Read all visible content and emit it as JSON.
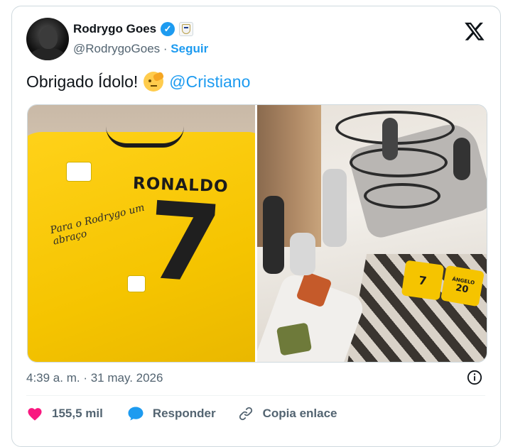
{
  "author": {
    "display_name": "Rodrygo Goes",
    "handle": "@RodrygoGoes",
    "separator": "·",
    "follow_label": "Seguir",
    "verified": true,
    "affiliation": "Real Madrid crest"
  },
  "tweet": {
    "text": "Obrigado Ídolo!",
    "emoji": "saluting-face",
    "mention": "@Cristiano"
  },
  "media": {
    "left_photo": {
      "shirt_name": "RONALDO",
      "shirt_number": "7",
      "autograph": "Para o Rodrygo um abraço"
    },
    "right_photo": {
      "jersey_left_number": "7",
      "jersey_right_name": "ÁNGELO",
      "jersey_right_number": "20"
    }
  },
  "timestamp": "4:39 a. m. · 31 may. 2026",
  "actions": {
    "like_count": "155,5 mil",
    "reply_label": "Responder",
    "copy_link_label": "Copia enlace"
  },
  "colors": {
    "accent": "#1d9bf0",
    "like": "#f91880",
    "muted": "#536471",
    "text": "#0f1419"
  }
}
